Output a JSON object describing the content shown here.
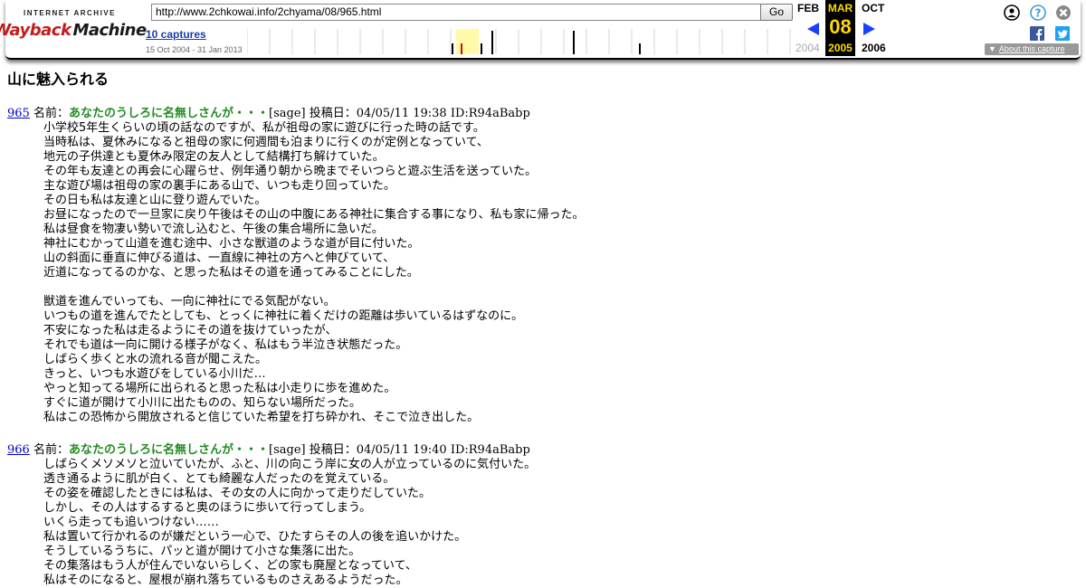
{
  "toolbar": {
    "logo_top": "INTERNET ARCHIVE",
    "logo_wayback": "Wayback",
    "logo_machine": "Machine",
    "url": "http://www.2chkowai.info/2chyama/08/965.html",
    "go_label": "Go",
    "captures_label": "10 captures",
    "date_range": "15 Oct 2004 - 31 Jan 2013",
    "prev_month": "FEB",
    "cur_month": "MAR",
    "next_month": "OCT",
    "cur_day": "08",
    "prev_year": "2004",
    "cur_year": "2005",
    "next_year": "2006",
    "about_label": "About this capture",
    "icons": {
      "user": "user-icon",
      "help": "help-icon",
      "close": "close-icon",
      "facebook": "facebook-icon",
      "twitter": "twitter-icon"
    },
    "colors": {
      "highlight_year": "#fff9a8",
      "current": "#ffd900",
      "arrow": "#1a40ff"
    }
  },
  "page": {
    "title": "山に魅入られる"
  },
  "posts": [
    {
      "number": "965",
      "name_prefix": "名前：",
      "name": "あなたのうしろに名無しさんが・・・",
      "meta": "[sage] 投稿日：04/05/11 19:38 ID:R94aBabp",
      "lines": [
        "小学校5年生くらいの頃の話なのですが、私が祖母の家に遊びに行った時の話です。",
        "当時私は、夏休みになると祖母の家に何週間も泊まりに行くのが定例となっていて、",
        "地元の子供達とも夏休み限定の友人として結構打ち解けていた。",
        "その年も友達との再会に心躍らせ、例年通り朝から晩までそいつらと遊ぶ生活を送っていた。",
        "主な遊び場は祖母の家の裏手にある山で、いつも走り回っていた。",
        "その日も私は友達と山に登り遊んでいた。",
        "お昼になったので一旦家に戻り午後はその山の中腹にある神社に集合する事になり、私も家に帰った。",
        "私は昼食を物凄い勢いで流し込むと、午後の集合場所に急いだ。",
        "神社にむかって山道を進む途中、小さな獣道のような道が目に付いた。",
        "山の斜面に垂直に伸びる道は、一直線に神社の方へと伸びていて、",
        "近道になってるのかな、と思った私はその道を通ってみることにした。",
        "",
        "獣道を進んでいっても、一向に神社にでる気配がない。",
        "いつもの道を進んでたとしても、とっくに神社に着くだけの距離は歩いているはずなのに。",
        "不安になった私は走るようにその道を抜けていったが、",
        "それでも道は一向に開ける様子がなく、私はもう半泣き状態だった。",
        "しばらく歩くと水の流れる音が聞こえた。",
        "きっと、いつも水遊びをしている小川だ…",
        "やっと知ってる場所に出られると思った私は小走りに歩を進めた。",
        "すぐに道が開けて小川に出たものの、知らない場所だった。",
        "私はこの恐怖から開放されると信じていた希望を打ち砕かれ、そこで泣き出した。"
      ]
    },
    {
      "number": "966",
      "name_prefix": "名前：",
      "name": "あなたのうしろに名無しさんが・・・",
      "meta": "[sage] 投稿日：04/05/11 19:40 ID:R94aBabp",
      "lines": [
        "しばらくメソメソと泣いていたが、ふと、川の向こう岸に女の人が立っているのに気付いた。",
        "透き通るように肌が白く、とても綺麗な人だったのを覚えている。",
        "その姿を確認したときには私は、その女の人に向かって走りだしていた。",
        "しかし、その人はするすると奥のほうに歩いて行ってしまう。",
        "いくら走っても追いつけない……",
        "私は置いて行かれるのが嫌だという一心で、ひたすらその人の後を追いかけた。",
        "そうしているうちに、パッと道が開けて小さな集落に出た。",
        "その集落はもう人が住んでいないらしく、どの家も廃屋となっていて、",
        "私はそのになると、屋根が崩れ落ちているものさえあるようだった。"
      ]
    }
  ]
}
